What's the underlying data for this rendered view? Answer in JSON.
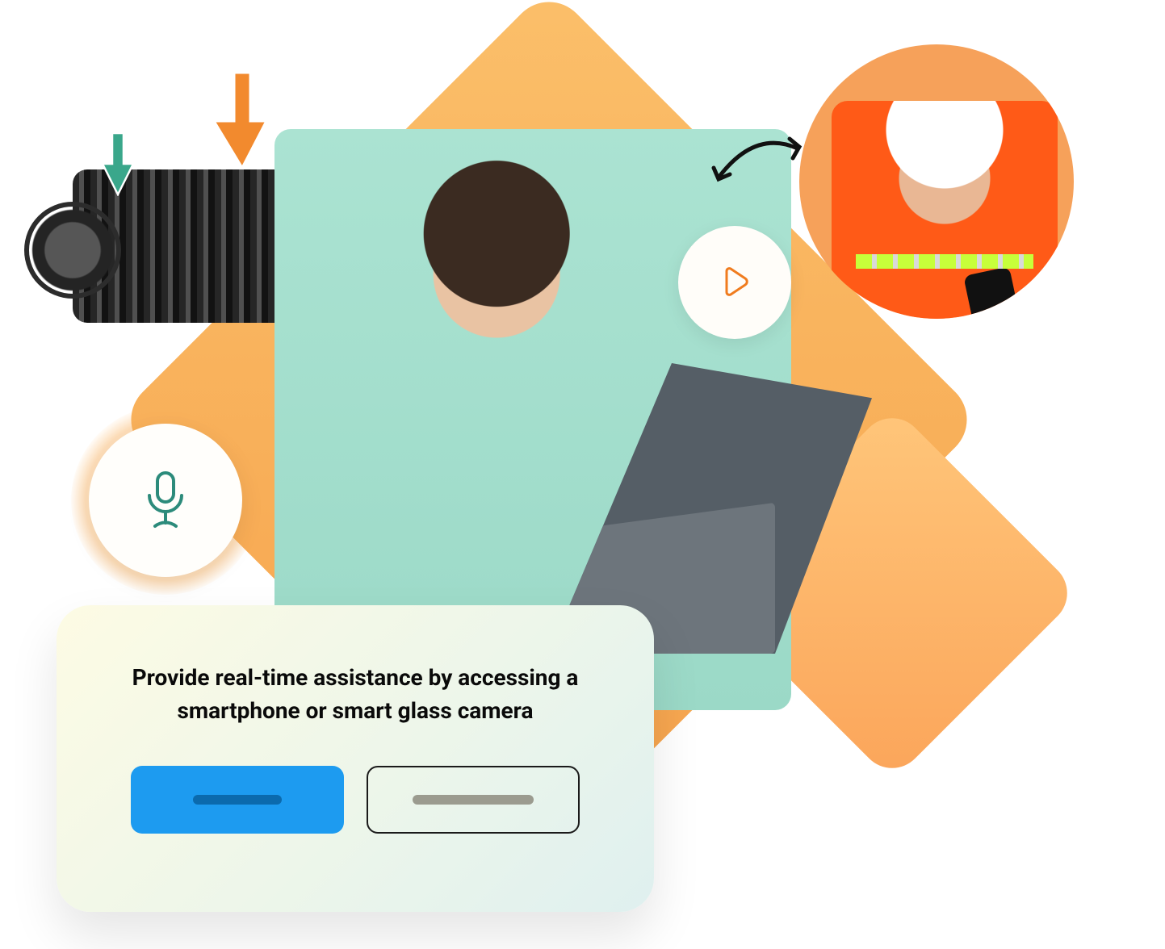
{
  "card": {
    "text": "Provide real-time assistance by accessing a smartphone or smart glass camera"
  },
  "icons": {
    "mic": "microphone-icon",
    "play": "play-icon",
    "swap": "swap-arrow-icon",
    "arrow_orange": "arrow-down-orange-icon",
    "arrow_green": "arrow-down-green-icon"
  },
  "colors": {
    "accent_orange": "#f6a24b",
    "accent_blue": "#1d9bf0",
    "mint": "#abe3d2",
    "teal": "#2c8b7b"
  }
}
